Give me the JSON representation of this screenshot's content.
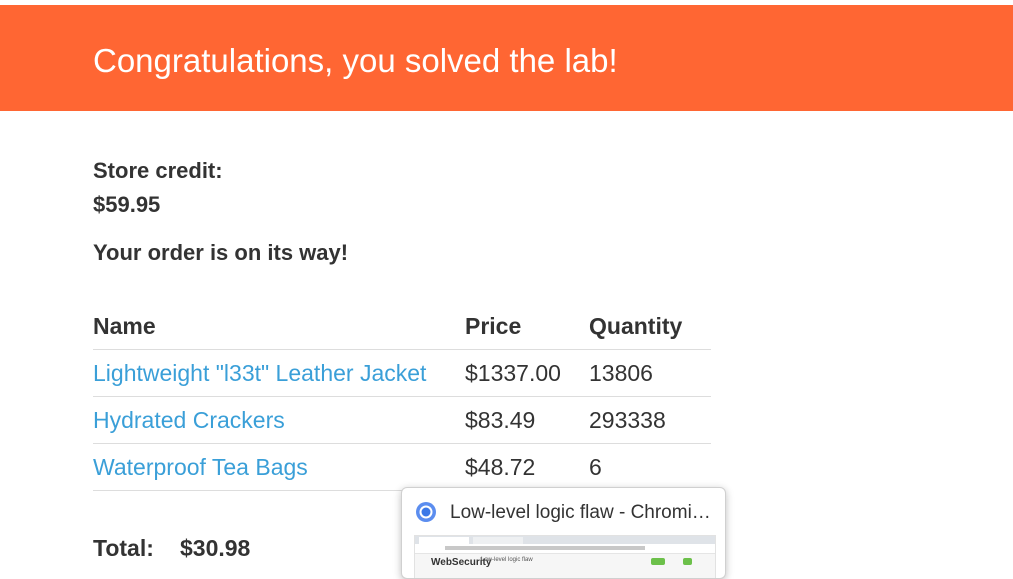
{
  "banner": {
    "message": "Congratulations, you solved the lab!",
    "color": "#ff6633"
  },
  "account": {
    "store_credit_label": "Store credit:",
    "store_credit_value": "$59.95"
  },
  "order": {
    "status_message": "Your order is on its way!",
    "columns": [
      "Name",
      "Price",
      "Quantity"
    ],
    "items": [
      {
        "name": "Lightweight \"l33t\" Leather Jacket",
        "price": "$1337.00",
        "quantity": "13806"
      },
      {
        "name": "Hydrated Crackers",
        "price": "$83.49",
        "quantity": "293338"
      },
      {
        "name": "Waterproof Tea Bags",
        "price": "$48.72",
        "quantity": "6"
      }
    ],
    "total_label": "Total:",
    "total_value": "$30.98",
    "link_color": "#3a9fd8"
  },
  "tab_preview": {
    "title": "Low-level logic flaw - Chromium",
    "icon": "chromium-icon",
    "thumbnail_logo": "WebSecurity",
    "thumbnail_heading": "Low-level logic flaw"
  }
}
